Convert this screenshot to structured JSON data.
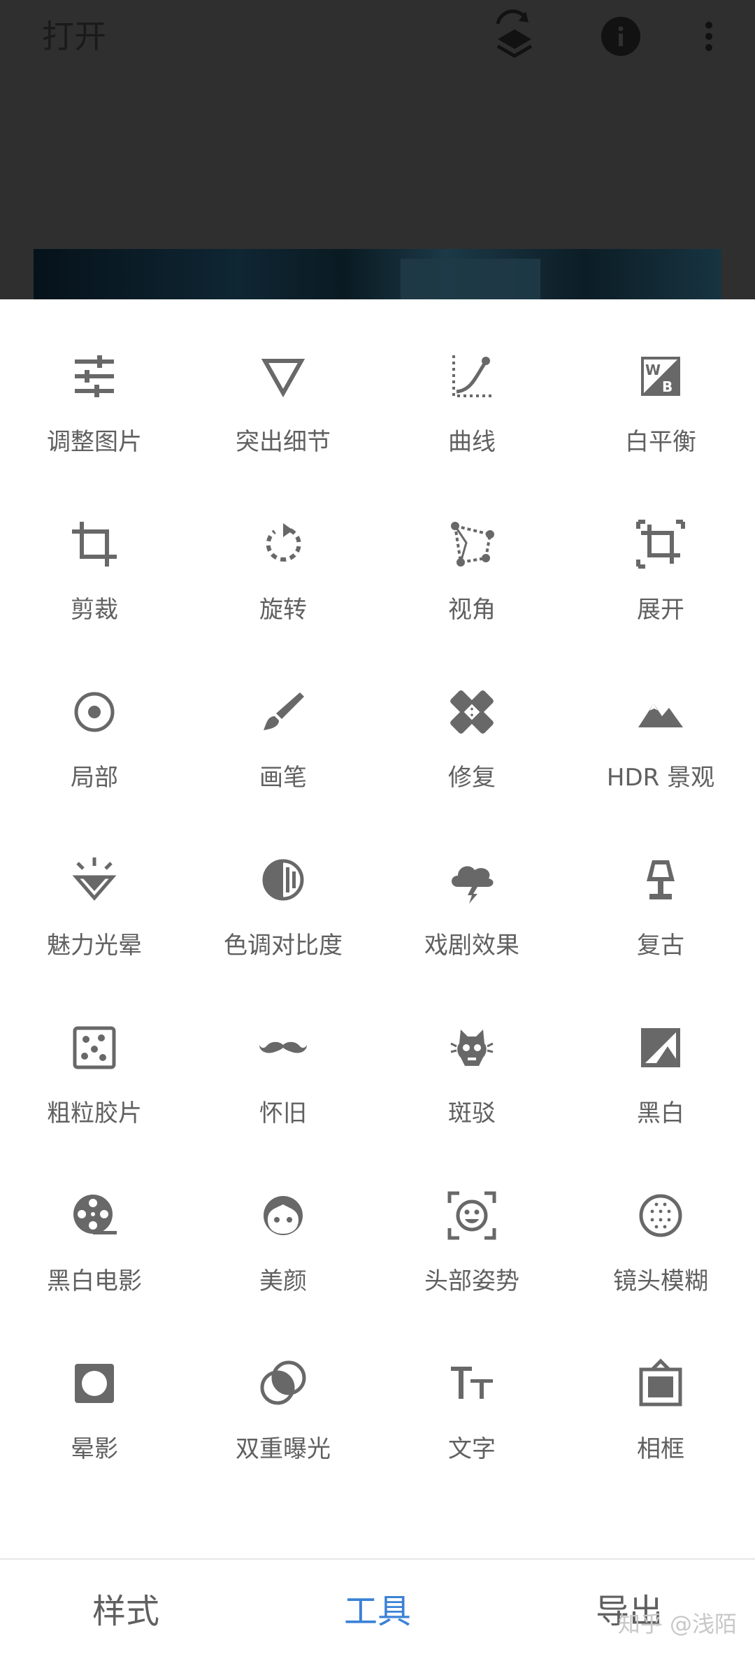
{
  "header": {
    "title": "打开",
    "icons": [
      "layers-rotate-icon",
      "info-icon",
      "more-vert-icon"
    ]
  },
  "tools": [
    {
      "label": "调整图片",
      "icon": "tune-icon"
    },
    {
      "label": "突出细节",
      "icon": "triangle-down-icon"
    },
    {
      "label": "曲线",
      "icon": "curve-icon"
    },
    {
      "label": "白平衡",
      "icon": "white-balance-icon"
    },
    {
      "label": "剪裁",
      "icon": "crop-icon"
    },
    {
      "label": "旋转",
      "icon": "rotate-icon"
    },
    {
      "label": "视角",
      "icon": "perspective-icon"
    },
    {
      "label": "展开",
      "icon": "expand-icon"
    },
    {
      "label": "局部",
      "icon": "selective-icon"
    },
    {
      "label": "画笔",
      "icon": "brush-icon"
    },
    {
      "label": "修复",
      "icon": "healing-icon"
    },
    {
      "label": "HDR 景观",
      "icon": "mountain-icon"
    },
    {
      "label": "魅力光晕",
      "icon": "glamour-diamond-icon"
    },
    {
      "label": "色调对比度",
      "icon": "tonal-contrast-icon"
    },
    {
      "label": "戏剧效果",
      "icon": "storm-cloud-icon"
    },
    {
      "label": "复古",
      "icon": "lamp-icon"
    },
    {
      "label": "粗粒胶片",
      "icon": "grain-icon"
    },
    {
      "label": "怀旧",
      "icon": "mustache-icon"
    },
    {
      "label": "斑驳",
      "icon": "grunge-icon"
    },
    {
      "label": "黑白",
      "icon": "black-white-icon"
    },
    {
      "label": "黑白电影",
      "icon": "film-reel-icon"
    },
    {
      "label": "美颜",
      "icon": "face-icon"
    },
    {
      "label": "头部姿势",
      "icon": "face-frame-icon"
    },
    {
      "label": "镜头模糊",
      "icon": "lens-blur-icon"
    },
    {
      "label": "晕影",
      "icon": "vignette-icon"
    },
    {
      "label": "双重曝光",
      "icon": "double-exposure-icon"
    },
    {
      "label": "文字",
      "icon": "text-icon"
    },
    {
      "label": "相框",
      "icon": "frame-icon"
    }
  ],
  "tabs": [
    {
      "label": "样式",
      "active": false
    },
    {
      "label": "工具",
      "active": true
    },
    {
      "label": "导出",
      "active": false
    }
  ],
  "watermark": "知乎 @浅陌",
  "colors": {
    "icon": "#686868",
    "label": "#606060",
    "active_tab": "#3b82d6",
    "overlay": "#2f2f2f"
  }
}
